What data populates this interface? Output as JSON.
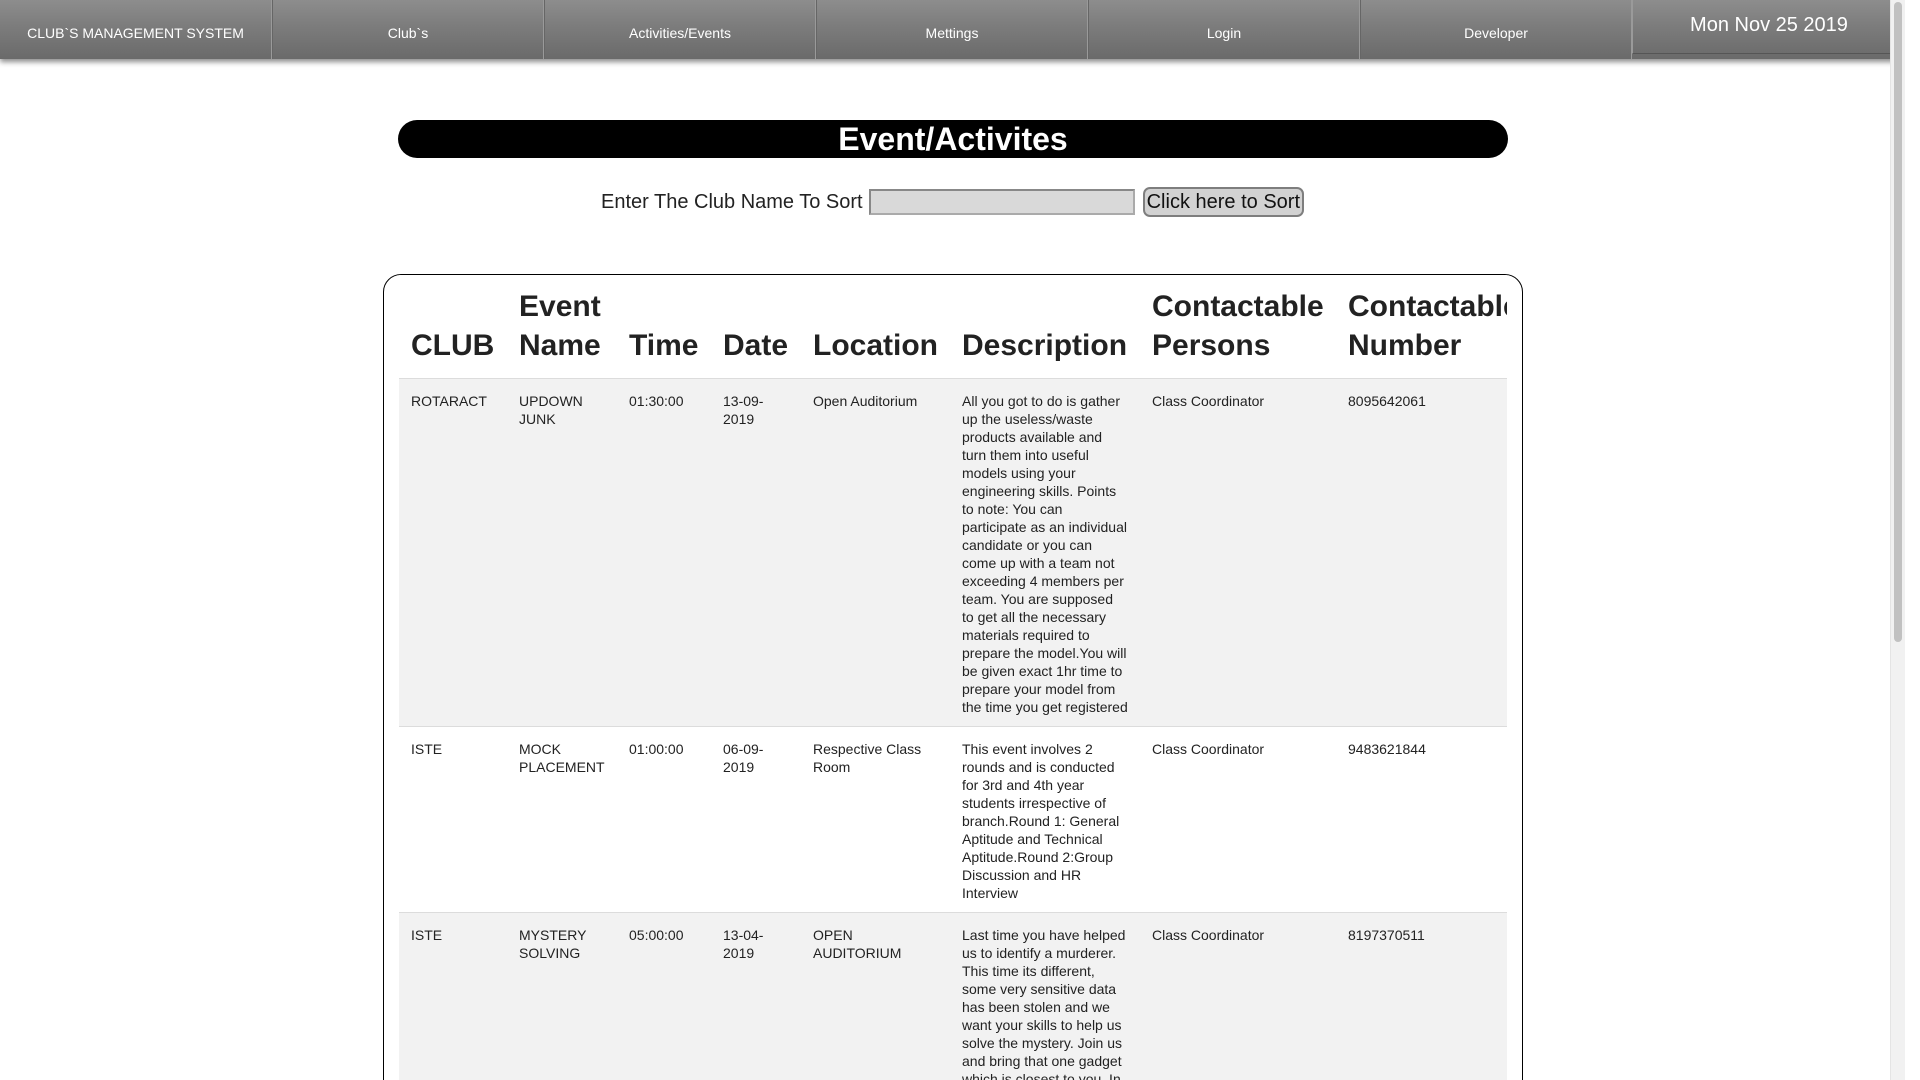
{
  "nav": {
    "items": [
      {
        "label": "CLUB`S MANAGEMENT SYSTEM"
      },
      {
        "label": "Club`s"
      },
      {
        "label": "Activities/Events"
      },
      {
        "label": "Mettings"
      },
      {
        "label": "Login"
      },
      {
        "label": "Developer"
      }
    ],
    "date": "Mon Nov 25 2019"
  },
  "page": {
    "title": "Event/Activites"
  },
  "sort": {
    "label": "Enter The Club Name To Sort",
    "input_value": "",
    "button_label": "Click here to Sort"
  },
  "table": {
    "headers": {
      "club": "CLUB",
      "event_name": "Event Name",
      "time": "Time",
      "date": "Date",
      "location": "Location",
      "description": "Description",
      "persons": "Contactable Persons",
      "number": "Contactable Number"
    },
    "rows": [
      {
        "club": "ROTARACT",
        "event_name": "UPDOWN JUNK",
        "time": "01:30:00",
        "date": "13-09-2019",
        "location": "Open Auditorium",
        "description": "All you got to do is gather up the useless/waste products available and turn them into useful models using your engineering skills. Points to note: You can participate as an individual candidate or you can come up with a team not exceeding 4 members per team. You are supposed to get all the necessary materials required to prepare the model.You will be given exact 1hr time to prepare your model from the time you get registered",
        "persons": "Class Coordinator",
        "number": "8095642061"
      },
      {
        "club": "ISTE",
        "event_name": "MOCK PLACEMENT",
        "time": "01:00:00",
        "date": "06-09-2019",
        "location": "Respective Class Room",
        "description": "This event involves 2 rounds and is conducted for 3rd and 4th year students irrespective of branch.Round 1: General Aptitude and Technical Aptitude.Round 2:Group Discussion and HR Interview",
        "persons": "Class Coordinator",
        "number": "9483621844"
      },
      {
        "club": "ISTE",
        "event_name": "MYSTERY SOLVING",
        "time": "05:00:00",
        "date": "13-04-2019",
        "location": "OPEN AUDITORIUM",
        "description": "Last time you have helped us to identify a murderer. This time its different, some very sensitive data has been stolen and we want your skills to help us solve the mystery. Join us and bring that one gadget which is closest to you. In",
        "persons": "Class Coordinator",
        "number": "8197370511"
      }
    ]
  }
}
